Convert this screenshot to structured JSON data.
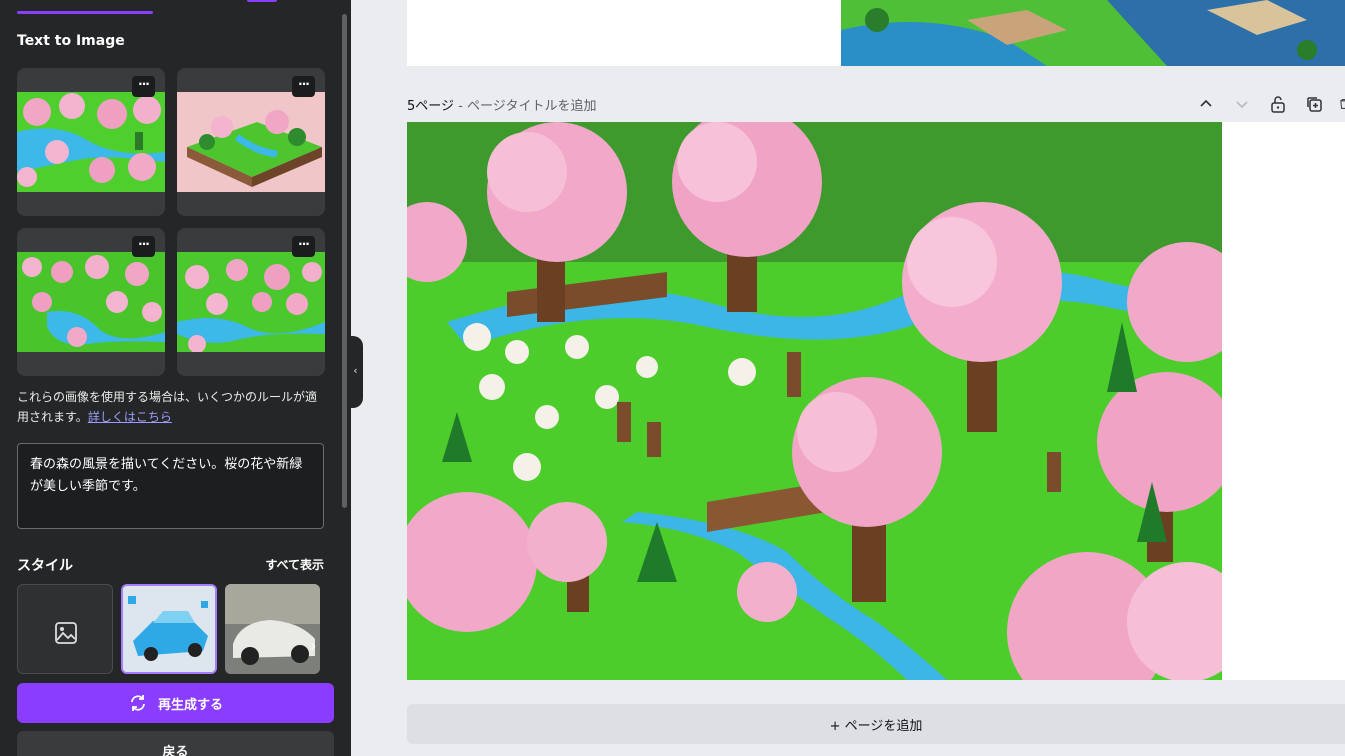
{
  "panel": {
    "section_title": "Text to Image",
    "thumbnails": [
      {
        "more": "···"
      },
      {
        "more": "···"
      },
      {
        "more": "···"
      },
      {
        "more": "···"
      }
    ],
    "rules_text": "これらの画像を使用する場合は、いくつかのルールが適用されます。",
    "rules_link": "詳しくはこちら",
    "prompt": "春の森の風景を描いてください。桜の花や新緑が美しい季節です。",
    "style_title": "スタイル",
    "show_all": "すべて表示",
    "regenerate": "再生成する",
    "back": "戻る"
  },
  "canvas": {
    "page_label": "5ページ",
    "page_title_sep": " - ",
    "page_title_placeholder": "ページタイトルを追加",
    "add_page": "+ ページを追加"
  },
  "colors": {
    "accent": "#8b3dff",
    "panel_bg": "#252627",
    "canvas_bg": "#ebecf0"
  }
}
